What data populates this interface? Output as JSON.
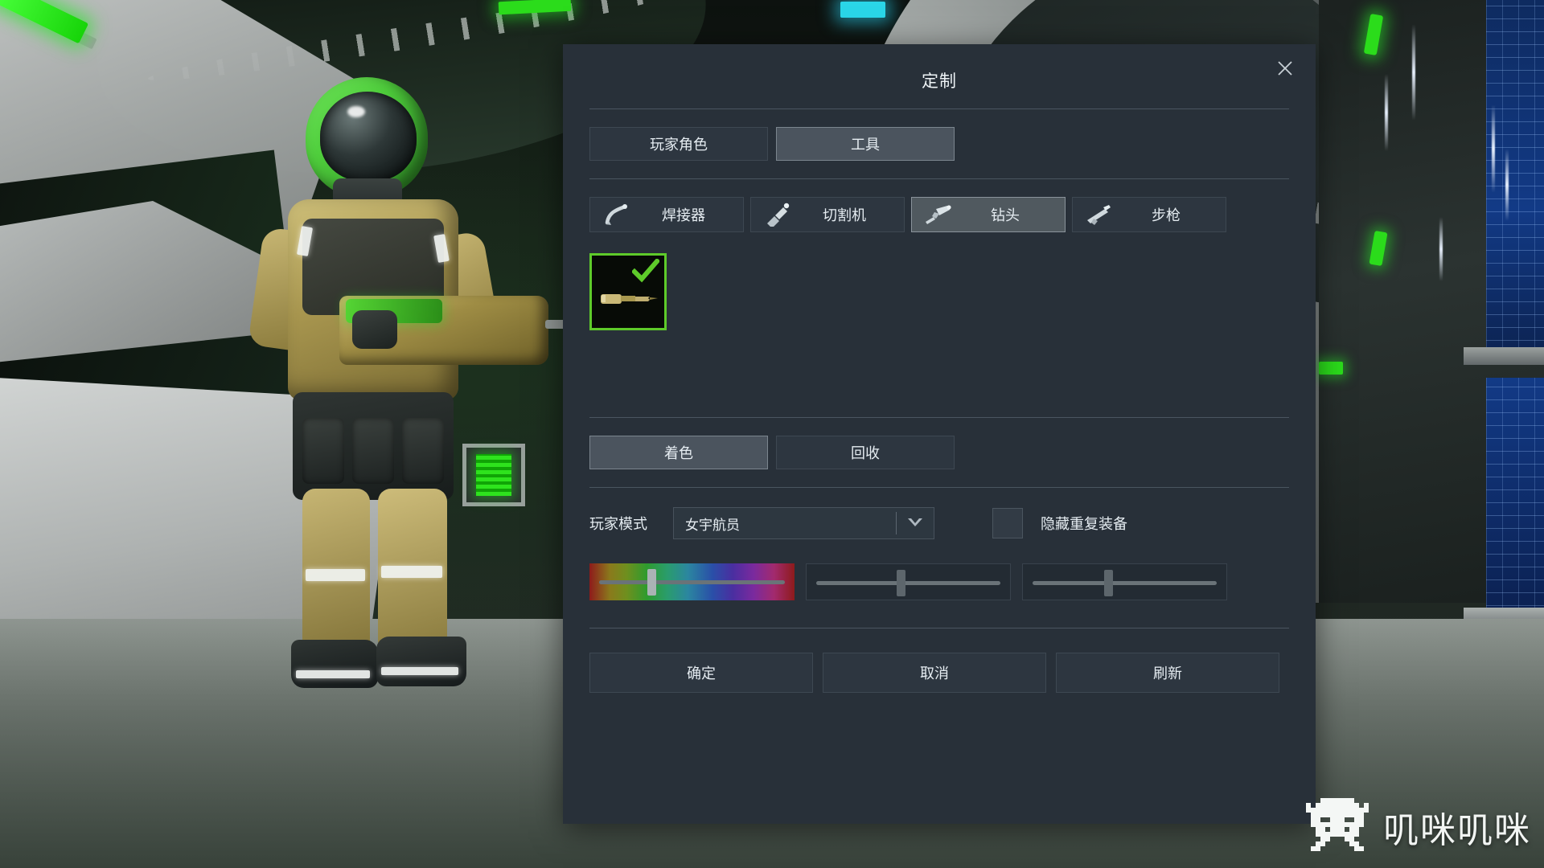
{
  "dialog": {
    "title": "定制",
    "close_icon": "close-icon",
    "main_tabs": [
      {
        "label": "玩家角色",
        "active": false
      },
      {
        "label": "工具",
        "active": true
      }
    ],
    "tool_tabs": [
      {
        "label": "焊接器",
        "icon": "welder-icon",
        "active": false
      },
      {
        "label": "切割机",
        "icon": "grinder-icon",
        "active": false
      },
      {
        "label": "钻头",
        "icon": "drill-icon",
        "active": true
      },
      {
        "label": "步枪",
        "icon": "rifle-icon",
        "active": false
      }
    ],
    "items": [
      {
        "name": "drill-skin-default",
        "selected": true,
        "check_icon": "check-icon"
      }
    ],
    "paint_buttons": [
      {
        "label": "着色",
        "active": true
      },
      {
        "label": "回收",
        "active": false
      }
    ],
    "mode": {
      "label": "玩家模式",
      "value": "女宇航员",
      "caret_icon": "chevron-down-icon",
      "checkbox_checked": false,
      "checkbox_label": "隐藏重复装备"
    },
    "sliders": [
      {
        "name": "hue",
        "type": "hue",
        "value": 31
      },
      {
        "name": "saturation",
        "type": "plain",
        "value": 38
      },
      {
        "name": "value",
        "type": "plain",
        "value": 42
      }
    ],
    "footer_buttons": [
      {
        "label": "确定"
      },
      {
        "label": "取消"
      },
      {
        "label": "刷新"
      }
    ],
    "colors": {
      "panel_bg": "#283039",
      "button_bg": "#2d3640",
      "button_active_bg": "#4b545e",
      "divider": "#4a5560",
      "text": "#e6edf2",
      "selection_green": "#5ecb2a"
    }
  },
  "watermark": {
    "icon": "space-invader-icon",
    "text": "叽咪叽咪"
  },
  "background": {
    "scene": "space-station-interior",
    "character": "female-astronaut-with-drill",
    "accent_green": "#2bdc1b",
    "accent_blue": "#2ad6e8"
  }
}
